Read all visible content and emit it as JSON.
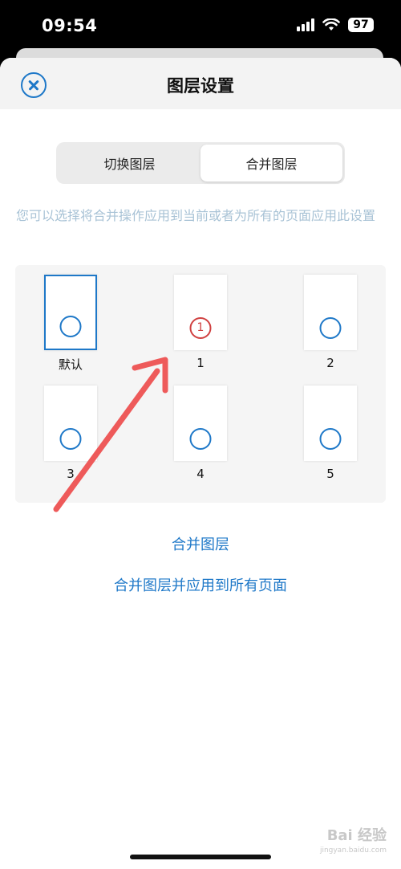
{
  "status": {
    "time": "09:54",
    "battery": "97"
  },
  "sheet": {
    "title": "图层设置"
  },
  "segments": [
    {
      "label": "切换图层",
      "active": false
    },
    {
      "label": "合并图层",
      "active": true
    }
  ],
  "description": "您可以选择将合并操作应用到当前或者为所有的页面应用此设置",
  "layers": [
    {
      "label": "默认",
      "selected": true,
      "marker": ""
    },
    {
      "label": "1",
      "selected": false,
      "marker": "1"
    },
    {
      "label": "2",
      "selected": false,
      "marker": ""
    },
    {
      "label": "3",
      "selected": false,
      "marker": ""
    },
    {
      "label": "4",
      "selected": false,
      "marker": ""
    },
    {
      "label": "5",
      "selected": false,
      "marker": ""
    }
  ],
  "actions": {
    "merge": "合并图层",
    "merge_all": "合并图层并应用到所有页面"
  },
  "watermark": {
    "brand": "Bai 经验",
    "url": "jingyan.baidu.com"
  },
  "colors": {
    "accent": "#1e78c8",
    "marker": "#d04040",
    "annotation": "#ee5a5a"
  }
}
